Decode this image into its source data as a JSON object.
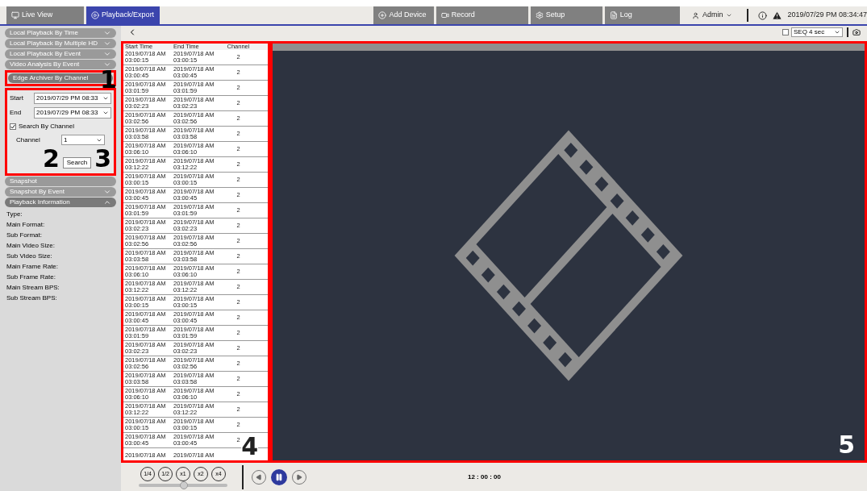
{
  "top_tabs": [
    {
      "label": "Live View",
      "kind": "monitor",
      "selected": false
    },
    {
      "label": "Playback/Export",
      "kind": "play",
      "selected": true
    },
    {
      "label": "Add Device",
      "kind": "add",
      "selected": false
    },
    {
      "label": "Record",
      "kind": "record",
      "selected": false
    },
    {
      "label": "Setup",
      "kind": "setup",
      "selected": false
    },
    {
      "label": "Log",
      "kind": "log",
      "selected": false
    }
  ],
  "user": {
    "label": "Admin"
  },
  "datetime": "2019/07/29 PM 08:34:47",
  "toolbar": {
    "seq_checkbox": {
      "checked": false
    },
    "seq_select": "SEQ 4 sec"
  },
  "sidebar": {
    "sections": [
      {
        "title": "Local Playback By Time",
        "expanded": false,
        "chevron": true
      },
      {
        "title": "Local Playback By Multiple HD",
        "expanded": false,
        "chevron": true
      },
      {
        "title": "Local Playback By Event",
        "expanded": false,
        "chevron": true
      },
      {
        "title": "Video Analysis By Event",
        "expanded": false,
        "chevron": true
      },
      {
        "title": "Edge Archiver By Channel",
        "expanded": true,
        "chevron": false,
        "kind": "edge"
      },
      {
        "title": "Snapshot",
        "expanded": false,
        "chevron": false
      },
      {
        "title": "Snapshot By Event",
        "expanded": false,
        "chevron": true
      },
      {
        "title": "Playback Information",
        "expanded": true,
        "chevron": true,
        "kind": "info"
      }
    ]
  },
  "edge_form": {
    "start_label": "Start",
    "start_value": "2019/07/29 PM 08:33",
    "end_label": "End",
    "end_value": "2019/07/29 PM 08:33",
    "search_by_channel": {
      "label": "Search By Channel",
      "checked": true
    },
    "channel_label": "Channel",
    "channel_value": "1",
    "search_button": "Search"
  },
  "playback_info": [
    "Type:",
    "Main Format:",
    "Sub Format:",
    "Main Video Size:",
    "Sub Video Size:",
    "Main Frame Rate:",
    "Sub Frame Rate:",
    "Main Stream BPS:",
    "Sub Stream BPS:"
  ],
  "table": {
    "columns": [
      "Start Time",
      "End Time",
      "Channel"
    ],
    "rows": [
      [
        "2019/07/18  AM 03:00:15",
        "2019/07/18  AM 03:00:15",
        "2"
      ],
      [
        "2019/07/18  AM 03:00:45",
        "2019/07/18  AM 03:00:45",
        "2"
      ],
      [
        "2019/07/18  AM 03:01:59",
        "2019/07/18  AM 03:01:59",
        "2"
      ],
      [
        "2019/07/18  AM 03:02:23",
        "2019/07/18  AM 03:02:23",
        "2"
      ],
      [
        "2019/07/18  AM 03:02:56",
        "2019/07/18  AM 03:02:56",
        "2"
      ],
      [
        "2019/07/18  AM 03:03:58",
        "2019/07/18  AM 03:03:58",
        "2"
      ],
      [
        "2019/07/18  AM 03:06:10",
        "2019/07/18  AM 03:06:10",
        "2"
      ],
      [
        "2019/07/18  AM 03:12:22",
        "2019/07/18  AM 03:12:22",
        "2"
      ],
      [
        "2019/07/18  AM 03:00:15",
        "2019/07/18  AM 03:00:15",
        "2"
      ],
      [
        "2019/07/18  AM 03:00:45",
        "2019/07/18  AM 03:00:45",
        "2"
      ],
      [
        "2019/07/18  AM 03:01:59",
        "2019/07/18  AM 03:01:59",
        "2"
      ],
      [
        "2019/07/18  AM 03:02:23",
        "2019/07/18  AM 03:02:23",
        "2"
      ],
      [
        "2019/07/18  AM 03:02:56",
        "2019/07/18  AM 03:02:56",
        "2"
      ],
      [
        "2019/07/18  AM 03:03:58",
        "2019/07/18  AM 03:03:58",
        "2"
      ],
      [
        "2019/07/18  AM 03:06:10",
        "2019/07/18  AM 03:06:10",
        "2"
      ],
      [
        "2019/07/18  AM 03:12:22",
        "2019/07/18  AM 03:12:22",
        "2"
      ],
      [
        "2019/07/18  AM 03:00:15",
        "2019/07/18  AM 03:00:15",
        "2"
      ],
      [
        "2019/07/18  AM 03:00:45",
        "2019/07/18  AM 03:00:45",
        "2"
      ],
      [
        "2019/07/18  AM 03:01:59",
        "2019/07/18  AM 03:01:59",
        "2"
      ],
      [
        "2019/07/18  AM 03:02:23",
        "2019/07/18  AM 03:02:23",
        "2"
      ],
      [
        "2019/07/18  AM 03:02:56",
        "2019/07/18  AM 03:02:56",
        "2"
      ],
      [
        "2019/07/18  AM 03:03:58",
        "2019/07/18  AM 03:03:58",
        "2"
      ],
      [
        "2019/07/18  AM 03:06:10",
        "2019/07/18  AM 03:06:10",
        "2"
      ],
      [
        "2019/07/18  AM 03:12:22",
        "2019/07/18  AM 03:12:22",
        "2"
      ],
      [
        "2019/07/18  AM 03:00:15",
        "2019/07/18  AM 03:00:15",
        "2"
      ],
      [
        "2019/07/18  AM 03:00:45",
        "2019/07/18  AM 03:00:45",
        "2"
      ],
      [
        "2019/07/18  AM",
        "2019/07/18  AM",
        ""
      ]
    ]
  },
  "playback": {
    "speeds": [
      "1/4",
      "1/2",
      "x1",
      "x2",
      "x4"
    ],
    "speed_slider": {
      "level": 0.51
    },
    "playing": true,
    "time": "12 : 00 : 00"
  },
  "callouts": [
    "1",
    "2",
    "3",
    "4",
    "5"
  ]
}
